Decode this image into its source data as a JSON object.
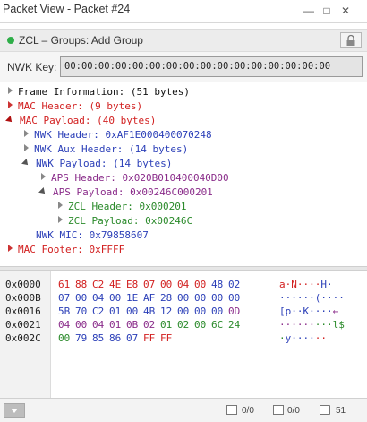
{
  "window": {
    "title": "Packet View - Packet #24",
    "minimize": "—",
    "maximize": "□",
    "close": "✕"
  },
  "info_bar": {
    "status_color": "#2eae48",
    "text": "ZCL – Groups: Add Group"
  },
  "nwk_key": {
    "label": "NWK Key:",
    "value": "00:00:00:00:00:00:00:00:00:00:00:00:00:00:00:00"
  },
  "tree": [
    {
      "text": "Frame Information: (51 bytes)",
      "color": "black",
      "expanded": false,
      "level": 0
    },
    {
      "text": "MAC Header: (9 bytes)",
      "color": "red",
      "expanded": false,
      "level": 0
    },
    {
      "text": "MAC Payload: (40 bytes)",
      "color": "red",
      "expanded": true,
      "level": 0
    },
    {
      "text": "NWK Header: 0xAF1E000400070248",
      "color": "blue",
      "expanded": false,
      "level": 1
    },
    {
      "text": "NWK Aux Header: (14 bytes)",
      "color": "blue",
      "expanded": false,
      "level": 1
    },
    {
      "text": "NWK Payload: (14 bytes)",
      "color": "blue",
      "expanded": true,
      "level": 1
    },
    {
      "text": "APS Header: 0x020B010400040D00",
      "color": "purple",
      "expanded": false,
      "level": 2
    },
    {
      "text": "APS Payload: 0x00246C000201",
      "color": "purple",
      "expanded": true,
      "level": 2
    },
    {
      "text": "ZCL Header: 0x000201",
      "color": "green",
      "expanded": false,
      "level": 3
    },
    {
      "text": "ZCL Payload: 0x00246C",
      "color": "green",
      "expanded": false,
      "level": 3
    },
    {
      "text": "NWK MIC: 0x79858607",
      "color": "blue",
      "expanded": null,
      "level": 1
    },
    {
      "text": "MAC Footer: 0xFFFF",
      "color": "red",
      "expanded": false,
      "level": 0
    }
  ],
  "colors": {
    "black": "#111111",
    "red": "#d22020",
    "blue": "#2b3fb8",
    "purple": "#8a2c8a",
    "green": "#2a8a2a"
  },
  "hex_dump": {
    "offsets": [
      "0x0000",
      "0x000B",
      "0x0016",
      "0x0021",
      "0x002C"
    ],
    "rows": [
      {
        "bytes": [
          [
            "61",
            "red"
          ],
          [
            "88",
            "red"
          ],
          [
            "C2",
            "red"
          ],
          [
            "4E",
            "red"
          ],
          [
            "E8",
            "red"
          ],
          [
            "07",
            "red"
          ],
          [
            "00",
            "red"
          ],
          [
            "04",
            "red"
          ],
          [
            "00",
            "red"
          ],
          [
            "48",
            "blue"
          ],
          [
            "02",
            "blue"
          ]
        ]
      },
      {
        "bytes": [
          [
            "07",
            "blue"
          ],
          [
            "00",
            "blue"
          ],
          [
            "04",
            "blue"
          ],
          [
            "00",
            "blue"
          ],
          [
            "1E",
            "blue"
          ],
          [
            "AF",
            "blue"
          ],
          [
            "28",
            "blue"
          ],
          [
            "00",
            "blue"
          ],
          [
            "00",
            "blue"
          ],
          [
            "00",
            "blue"
          ],
          [
            "00",
            "blue"
          ]
        ]
      },
      {
        "bytes": [
          [
            "5B",
            "blue"
          ],
          [
            "70",
            "blue"
          ],
          [
            "C2",
            "blue"
          ],
          [
            "01",
            "blue"
          ],
          [
            "00",
            "blue"
          ],
          [
            "4B",
            "blue"
          ],
          [
            "12",
            "blue"
          ],
          [
            "00",
            "blue"
          ],
          [
            "00",
            "blue"
          ],
          [
            "00",
            "blue"
          ],
          [
            "0D",
            "purple"
          ]
        ]
      },
      {
        "bytes": [
          [
            "04",
            "purple"
          ],
          [
            "00",
            "purple"
          ],
          [
            "04",
            "purple"
          ],
          [
            "01",
            "purple"
          ],
          [
            "0B",
            "purple"
          ],
          [
            "02",
            "purple"
          ],
          [
            "01",
            "green"
          ],
          [
            "02",
            "green"
          ],
          [
            "00",
            "green"
          ],
          [
            "6C",
            "green"
          ],
          [
            "24",
            "green"
          ]
        ]
      },
      {
        "bytes": [
          [
            "00",
            "green"
          ],
          [
            "79",
            "blue"
          ],
          [
            "85",
            "blue"
          ],
          [
            "86",
            "blue"
          ],
          [
            "07",
            "blue"
          ],
          [
            "FF",
            "red"
          ],
          [
            "FF",
            "red"
          ]
        ]
      }
    ],
    "ascii": [
      [
        [
          "a·N····",
          "red"
        ],
        [
          "H·",
          "blue"
        ]
      ],
      [
        [
          "······(····",
          "blue"
        ]
      ],
      [
        [
          "[p··K····",
          "blue"
        ],
        [
          "←",
          "purple"
        ]
      ],
      [
        [
          "······",
          "purple"
        ],
        [
          "···l$",
          "green"
        ]
      ],
      [
        [
          "·",
          "green"
        ],
        [
          "y····",
          "blue"
        ],
        [
          "··",
          "red"
        ]
      ]
    ]
  },
  "status_bar": {
    "count1": "0/0",
    "count2": "0/0",
    "count3": "51"
  }
}
